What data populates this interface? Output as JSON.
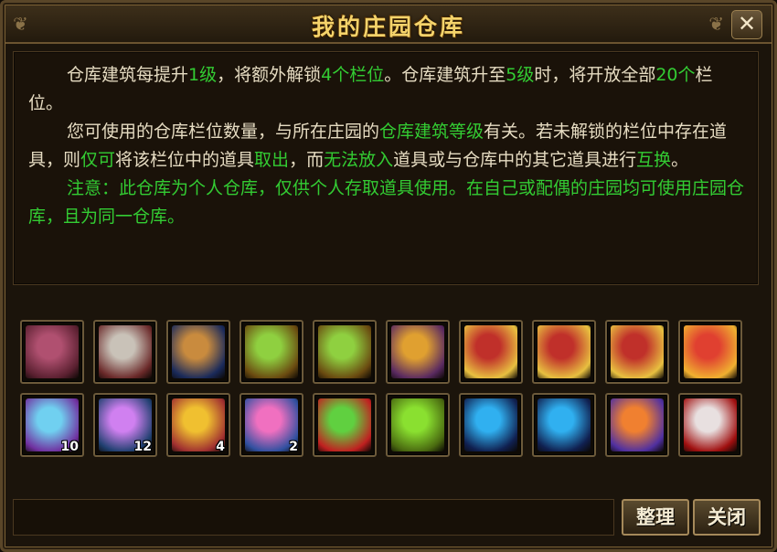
{
  "window": {
    "title": "我的庄园仓库",
    "close_glyph": "✕"
  },
  "info": {
    "p1": [
      {
        "t": "仓库建筑每提升"
      },
      {
        "t": "1级",
        "g": true
      },
      {
        "t": "，将额外解锁"
      },
      {
        "t": "4个栏位",
        "g": true
      },
      {
        "t": "。仓库建筑升至"
      },
      {
        "t": "5级",
        "g": true
      },
      {
        "t": "时，将开放全部"
      },
      {
        "t": "20个",
        "g": true
      },
      {
        "t": "栏位。"
      }
    ],
    "p2": [
      {
        "t": "您可使用的仓库栏位数量，与所在庄园的"
      },
      {
        "t": "仓库建筑等级",
        "g": true
      },
      {
        "t": "有关。若未解锁的栏位中存在道具，则"
      },
      {
        "t": "仅可",
        "g": true
      },
      {
        "t": "将该栏位中的道具"
      },
      {
        "t": "取出",
        "g": true
      },
      {
        "t": "，而"
      },
      {
        "t": "无法放入",
        "g": true
      },
      {
        "t": "道具或与仓库中的其它道具进行"
      },
      {
        "t": "互换",
        "g": true
      },
      {
        "t": "。"
      }
    ],
    "p3": [
      {
        "t": "注意：此仓库为个人仓库，仅供个人存取道具使用。在自己或配偶的庄园均可使用庄园仓库，且为同一仓库。",
        "g": true
      }
    ]
  },
  "items": [
    {
      "icon": "gem-bracelet-icon",
      "c1": "#b05070",
      "c2": "#5a2030",
      "qty": ""
    },
    {
      "icon": "white-horse-icon",
      "c1": "#c9c2b8",
      "c2": "#6b2a2a",
      "qty": ""
    },
    {
      "icon": "claw-fang-icon",
      "c1": "#c98b3e",
      "c2": "#1a2a5a",
      "qty": ""
    },
    {
      "icon": "green-bamboo-icon",
      "c1": "#8fd040",
      "c2": "#6a4a10",
      "qty": ""
    },
    {
      "icon": "green-bamboo-icon",
      "c1": "#8fd040",
      "c2": "#6a4a10",
      "qty": ""
    },
    {
      "icon": "golden-chest-icon",
      "c1": "#e0a030",
      "c2": "#5a2a60",
      "qty": ""
    },
    {
      "icon": "red-book-icon",
      "c1": "#c0302a",
      "c2": "#e8c040",
      "qty": ""
    },
    {
      "icon": "red-book-icon",
      "c1": "#c0302a",
      "c2": "#e8c040",
      "qty": ""
    },
    {
      "icon": "red-book-icon",
      "c1": "#c0302a",
      "c2": "#e8c040",
      "qty": ""
    },
    {
      "icon": "gift-box-icon",
      "c1": "#e04030",
      "c2": "#f0b030",
      "qty": ""
    },
    {
      "icon": "blue-crystal-icon",
      "c1": "#70d0f0",
      "c2": "#7030a0",
      "qty": "10"
    },
    {
      "icon": "purple-crystal-icon",
      "c1": "#d080f0",
      "c2": "#204070",
      "qty": "12"
    },
    {
      "icon": "golden-swirl-icon",
      "c1": "#f0c030",
      "c2": "#a03030",
      "qty": "4"
    },
    {
      "icon": "pink-orb-icon",
      "c1": "#f070c0",
      "c2": "#3050a0",
      "qty": "2"
    },
    {
      "icon": "green-red-orb-icon",
      "c1": "#60d040",
      "c2": "#c02020",
      "qty": ""
    },
    {
      "icon": "green-tent-icon",
      "c1": "#8ae030",
      "c2": "#4a6a10",
      "qty": ""
    },
    {
      "icon": "orb-in-hand-icon",
      "c1": "#30b0f0",
      "c2": "#102050",
      "qty": ""
    },
    {
      "icon": "orb-in-hand-icon",
      "c1": "#30b0f0",
      "c2": "#102050",
      "qty": ""
    },
    {
      "icon": "fire-orbs-icon",
      "c1": "#f08030",
      "c2": "#5030a0",
      "qty": ""
    },
    {
      "icon": "blood-stone-icon",
      "c1": "#e8e0e0",
      "c2": "#a01010",
      "qty": ""
    }
  ],
  "buttons": {
    "sort": "整理",
    "close": "关闭"
  }
}
